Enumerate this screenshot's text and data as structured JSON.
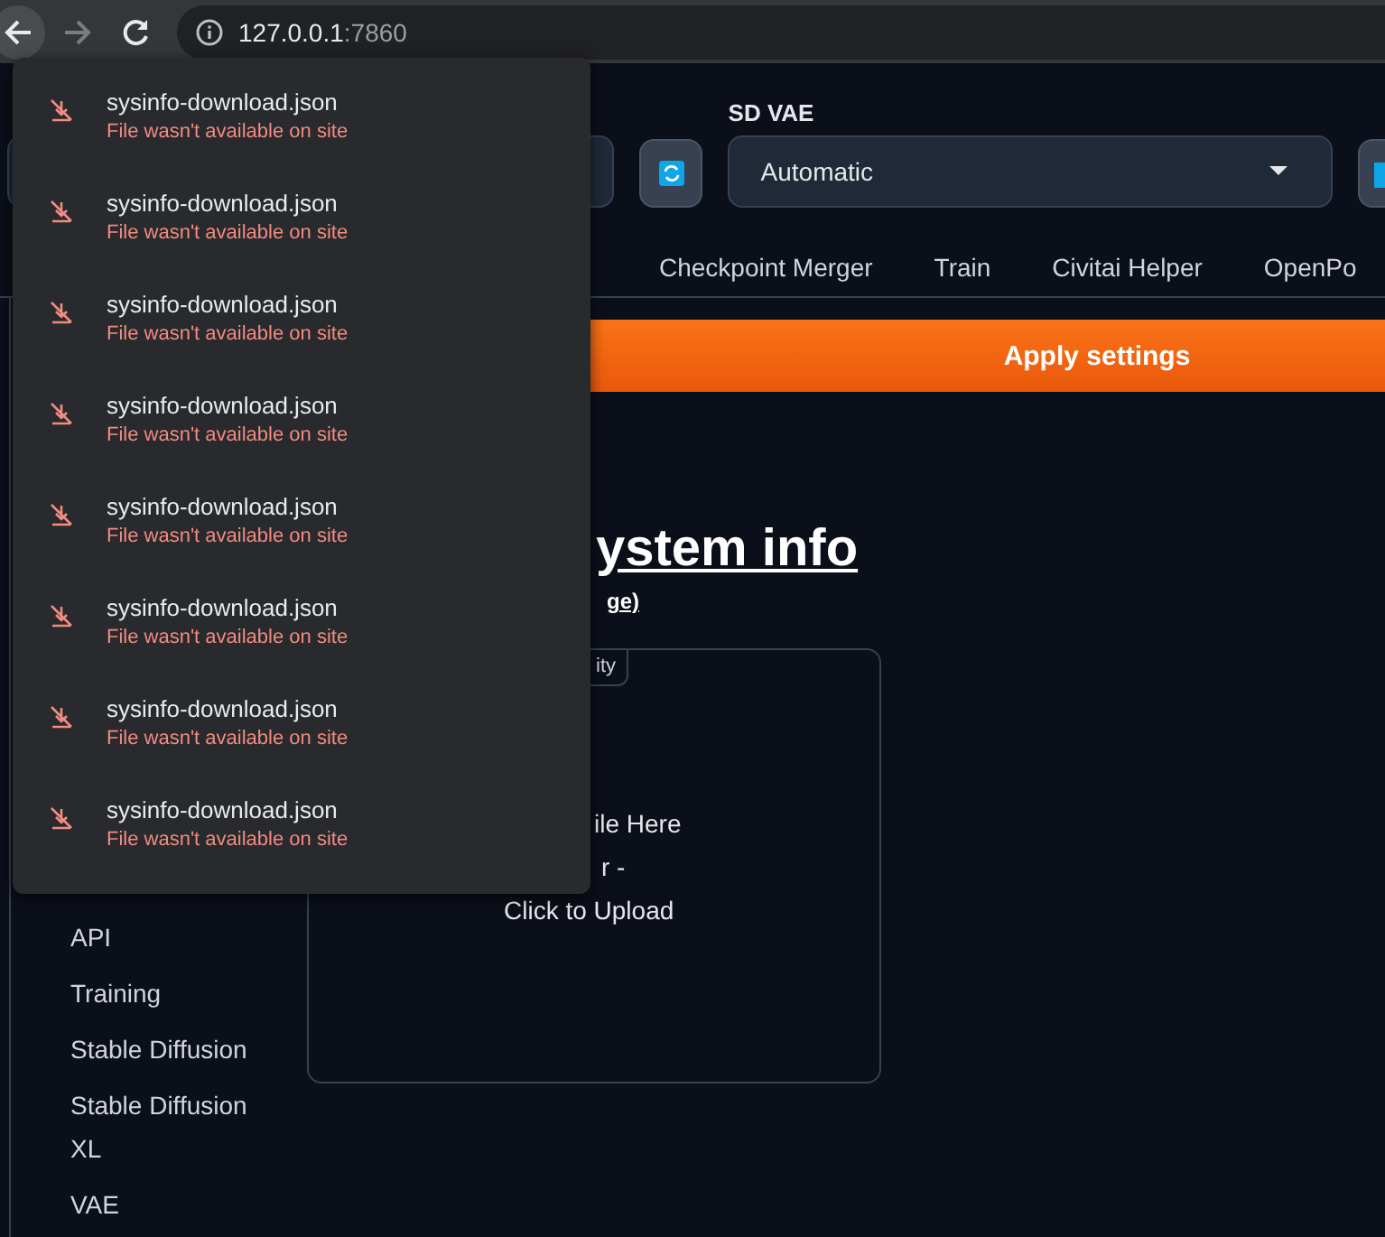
{
  "browser": {
    "forward_enabled": false,
    "url_host": "127.0.0.1",
    "url_port": ":7860"
  },
  "settings": {
    "vae_label": "SD VAE",
    "vae_value": "Automatic"
  },
  "tabs": [
    {
      "label": "Checkpoint Merger"
    },
    {
      "label": "Train"
    },
    {
      "label": "Civitai Helper"
    },
    {
      "label": "OpenPo"
    }
  ],
  "apply_button": "Apply settings",
  "heading": "ystem info",
  "subheading": "ge)",
  "upload": {
    "tab": "ity",
    "lines": [
      "ile Here",
      "r -",
      "Click to Upload"
    ]
  },
  "sidebar": {
    "items": [
      "API",
      "Training",
      "Stable Diffusion",
      "Stable Diffusion XL",
      "VAE"
    ]
  },
  "downloads": [
    {
      "file": "sysinfo-download.json",
      "status": "File wasn't available on site"
    },
    {
      "file": "sysinfo-download.json",
      "status": "File wasn't available on site"
    },
    {
      "file": "sysinfo-download.json",
      "status": "File wasn't available on site"
    },
    {
      "file": "sysinfo-download.json",
      "status": "File wasn't available on site"
    },
    {
      "file": "sysinfo-download.json",
      "status": "File wasn't available on site"
    },
    {
      "file": "sysinfo-download.json",
      "status": "File wasn't available on site"
    },
    {
      "file": "sysinfo-download.json",
      "status": "File wasn't available on site"
    },
    {
      "file": "sysinfo-download.json",
      "status": "File wasn't available on site"
    }
  ]
}
